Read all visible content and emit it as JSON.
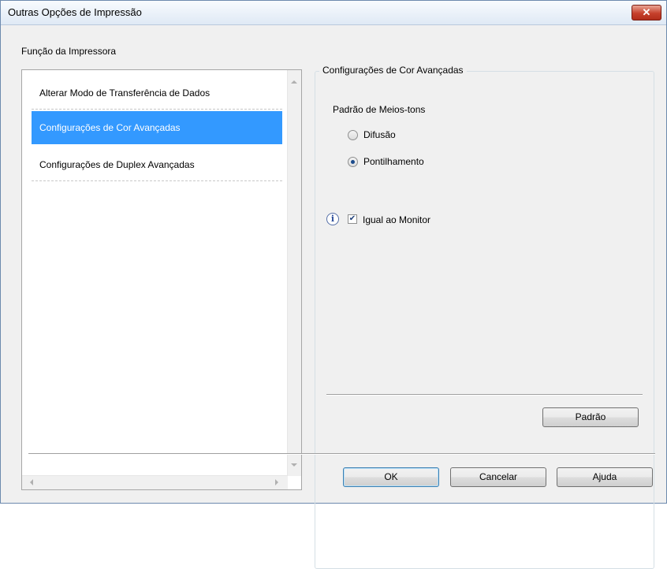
{
  "window": {
    "title": "Outras Opções de Impressão",
    "close_glyph": "✕"
  },
  "left_panel": {
    "group_label": "Função da Impressora",
    "items": [
      {
        "label": "Alterar Modo de Transferência de Dados",
        "selected": false
      },
      {
        "label": "Configurações de Cor Avançadas",
        "selected": true
      },
      {
        "label": "Configurações de Duplex Avançadas",
        "selected": false
      }
    ]
  },
  "right_panel": {
    "group_title": "Configurações de Cor Avançadas",
    "halftone_label": "Padrão de Meios-tons",
    "radio_options": [
      {
        "label": "Difusão",
        "checked": false
      },
      {
        "label": "Pontilhamento",
        "checked": true
      }
    ],
    "match_monitor": {
      "label": "Igual ao Monitor",
      "checked": true
    },
    "default_button": "Padrão"
  },
  "footer": {
    "ok": "OK",
    "cancel": "Cancelar",
    "help": "Ajuda"
  },
  "colors": {
    "selection": "#3399ff",
    "close_button": "#c6412c"
  },
  "icons": {
    "info": "info-icon",
    "close": "close-icon"
  }
}
